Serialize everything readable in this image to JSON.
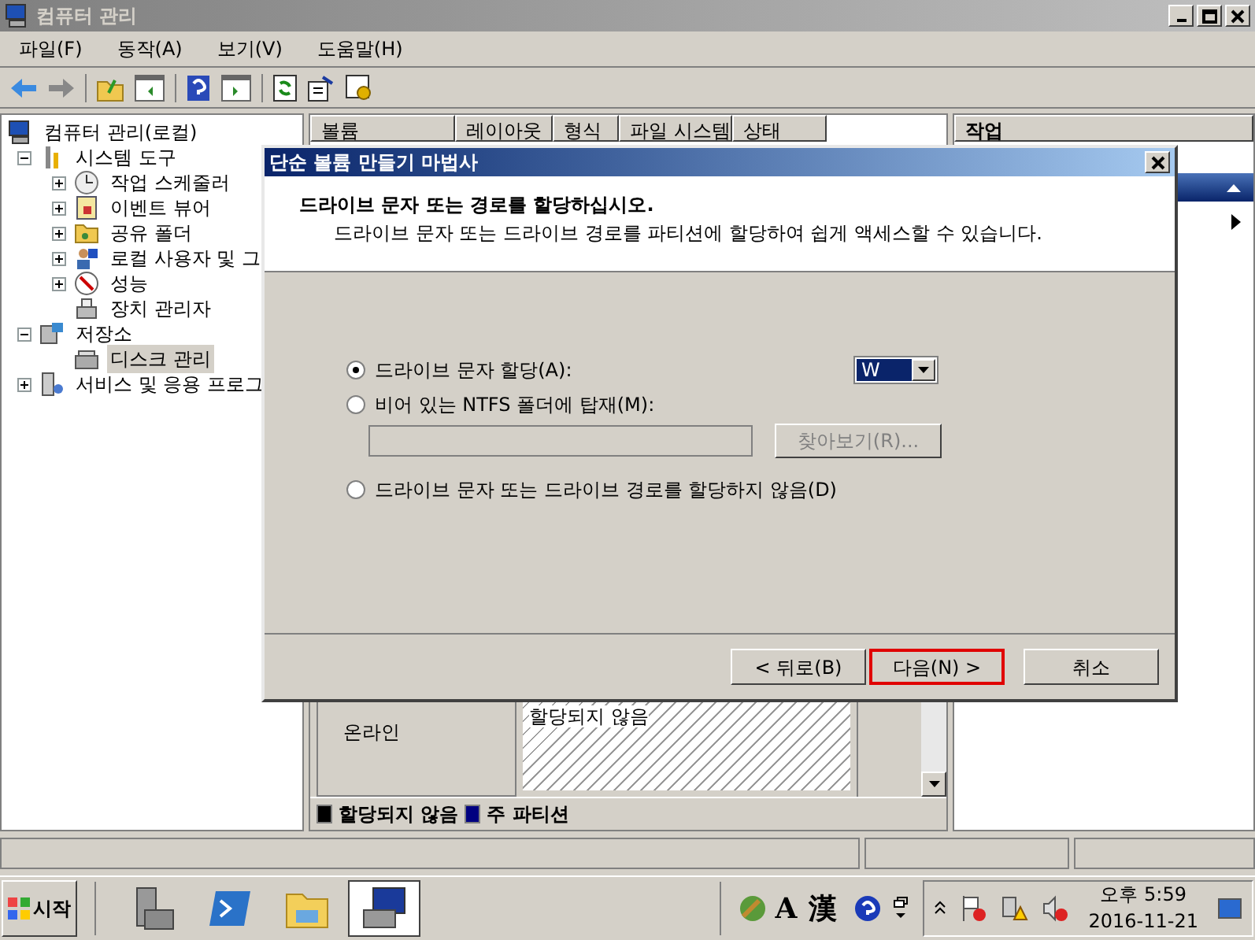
{
  "window": {
    "title": "컴퓨터 관리"
  },
  "menu": [
    "파일(F)",
    "동작(A)",
    "보기(V)",
    "도움말(H)"
  ],
  "tree": [
    {
      "label": "컴퓨터 관리(로컬)",
      "selected": false,
      "children": [
        {
          "label": "시스템 도구",
          "expanded": true,
          "selected": false,
          "children": [
            {
              "label": "작업 스케줄러",
              "expanded": false,
              "selected": false
            },
            {
              "label": "이벤트 뷰어",
              "expanded": false,
              "selected": false
            },
            {
              "label": "공유 폴더",
              "expanded": false,
              "selected": false
            },
            {
              "label": "로컬 사용자 및 그",
              "expanded": false,
              "selected": false
            },
            {
              "label": "성능",
              "expanded": false,
              "selected": false
            },
            {
              "label": "장치 관리자",
              "selected": false
            }
          ]
        },
        {
          "label": "저장소",
          "expanded": true,
          "selected": false,
          "children": [
            {
              "label": "디스크 관리",
              "selected": true
            }
          ]
        },
        {
          "label": "서비스 및 응용 프로그",
          "expanded": false,
          "selected": false
        }
      ]
    }
  ],
  "list": {
    "columns": [
      "볼륨",
      "레이아웃",
      "형식",
      "파일 시스템",
      "상태"
    ],
    "disk": {
      "status": "온라인",
      "partition": "할당되지 않음"
    },
    "legend": [
      {
        "label": "할당되지 않음",
        "color": "#000000"
      },
      {
        "label": "주 파티션",
        "color": "#000080"
      }
    ]
  },
  "actions": {
    "title": "작업"
  },
  "dialog": {
    "title": "단순 볼륨 만들기 마법사",
    "heading": "드라이브 문자 또는 경로를 할당하십시오.",
    "description": "드라이브 문자 또는 드라이브 경로를 파티션에 할당하여 쉽게 액세스할 수 있습니다.",
    "options": [
      {
        "label": "드라이브 문자 할당(A):",
        "selected": true,
        "kind": "letter",
        "value": "W"
      },
      {
        "label": "비어 있는 NTFS 폴더에 탑재(M):",
        "selected": false,
        "kind": "folder",
        "button": "찾아보기(R)...",
        "disabled": true
      },
      {
        "label": "드라이브 문자 또는 드라이브 경로를 할당하지 않음(D)",
        "selected": false,
        "kind": "none"
      }
    ],
    "buttons": [
      {
        "label": "< 뒤로(B)",
        "focused": false
      },
      {
        "label": "다음(N) >",
        "focused": true
      },
      {
        "label": "취소",
        "focused": false
      }
    ]
  },
  "taskbar": {
    "start": "시작",
    "apps": [
      {
        "active": false
      },
      {
        "active": false
      },
      {
        "active": false
      },
      {
        "active": true
      }
    ],
    "language": [
      "A",
      "漢"
    ],
    "time": "오후 5:59",
    "date": "2016-11-21"
  }
}
